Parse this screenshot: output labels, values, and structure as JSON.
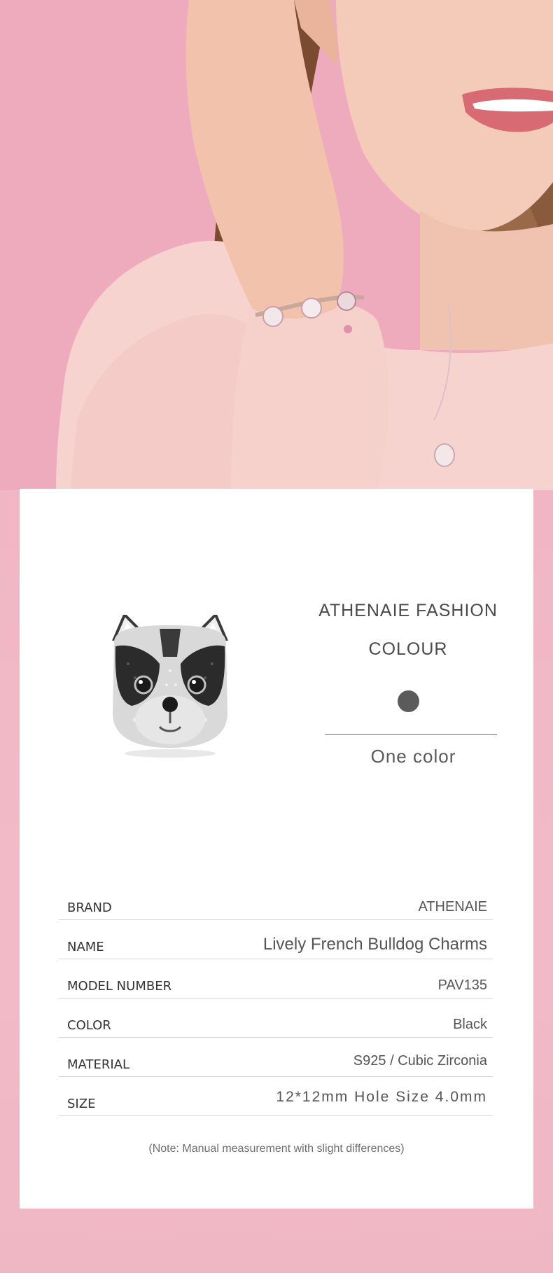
{
  "hero": {
    "image": "woman-wearing-charm-bracelet-photo"
  },
  "product": {
    "image": "french-bulldog-charm-icon",
    "brand_title": "ATHENAIE FASHION",
    "colour_heading": "COLOUR",
    "swatch_color": "#5b5b5b",
    "colour_value": "One color"
  },
  "specs": [
    {
      "label": "BRAND",
      "value": "ATHENAIE"
    },
    {
      "label": "NAME",
      "value": "Lively French Bulldog Charms"
    },
    {
      "label": "MODEL NUMBER",
      "value": "PAV135"
    },
    {
      "label": "COLOR",
      "value": "Black"
    },
    {
      "label": "MATERIAL",
      "value": "S925 / Cubic Zirconia"
    },
    {
      "label": "SIZE",
      "value": "12*12mm Hole Size 4.0mm"
    }
  ],
  "note": "(Note: Manual measurement with slight differences)",
  "colors": {
    "background_pink": "#f0b8c6",
    "card": "#ffffff",
    "text": "#4a4a4a"
  }
}
